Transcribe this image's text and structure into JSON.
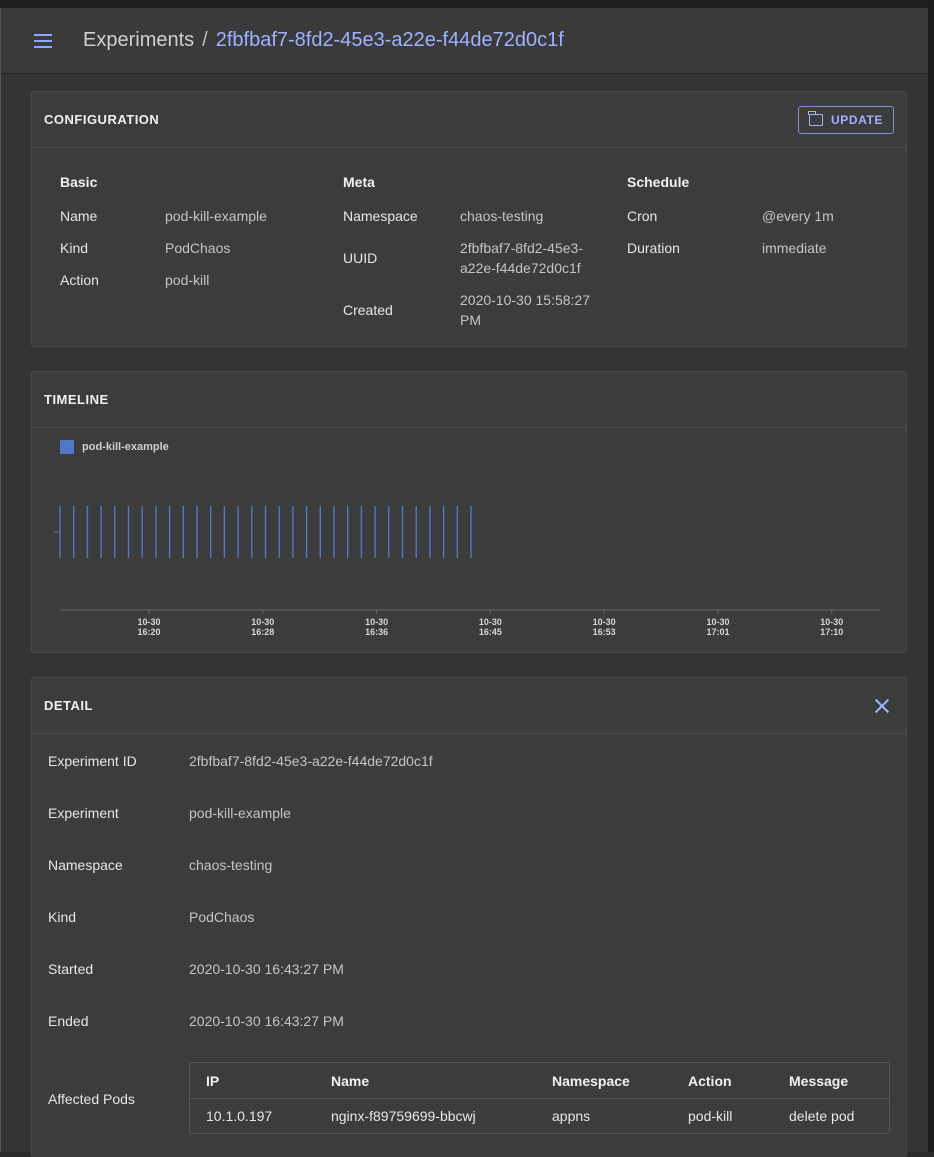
{
  "appbar": {
    "breadcrumb_root": "Experiments",
    "breadcrumb_sep": "/",
    "breadcrumb_current": "2fbfbaf7-8fd2-45e3-a22e-f44de72d0c1f"
  },
  "configuration": {
    "title": "CONFIGURATION",
    "update_label": "UPDATE",
    "basic": {
      "heading": "Basic",
      "name_key": "Name",
      "name_val": "pod-kill-example",
      "kind_key": "Kind",
      "kind_val": "PodChaos",
      "action_key": "Action",
      "action_val": "pod-kill"
    },
    "meta": {
      "heading": "Meta",
      "namespace_key": "Namespace",
      "namespace_val": "chaos-testing",
      "uuid_key": "UUID",
      "uuid_val_1": "2fbfbaf7-8fd2-45e3-",
      "uuid_val_2": "a22e-f44de72d0c1f",
      "created_key": "Created",
      "created_val_1": "2020-10-30 15:58:27",
      "created_val_2": "PM"
    },
    "schedule": {
      "heading": "Schedule",
      "cron_key": "Cron",
      "cron_val": "@every 1m",
      "duration_key": "Duration",
      "duration_val": "immediate"
    }
  },
  "timeline": {
    "title": "TIMELINE",
    "legend_label": "pod-kill-example",
    "series_color": "#4f79c4",
    "ticks": [
      {
        "date": "10-30",
        "time": "16:20"
      },
      {
        "date": "10-30",
        "time": "16:28"
      },
      {
        "date": "10-30",
        "time": "16:36"
      },
      {
        "date": "10-30",
        "time": "16:45"
      },
      {
        "date": "10-30",
        "time": "16:53"
      },
      {
        "date": "10-30",
        "time": "17:01"
      },
      {
        "date": "10-30",
        "time": "17:10"
      }
    ],
    "event_count": 31
  },
  "detail": {
    "title": "DETAIL",
    "rows": [
      {
        "key": "Experiment ID",
        "val": "2fbfbaf7-8fd2-45e3-a22e-f44de72d0c1f"
      },
      {
        "key": "Experiment",
        "val": "pod-kill-example"
      },
      {
        "key": "Namespace",
        "val": "chaos-testing"
      },
      {
        "key": "Kind",
        "val": "PodChaos"
      },
      {
        "key": "Started",
        "val": "2020-10-30 16:43:27 PM"
      },
      {
        "key": "Ended",
        "val": "2020-10-30 16:43:27 PM"
      }
    ],
    "affected_pods_label": "Affected Pods",
    "pods_columns": [
      "IP",
      "Name",
      "Namespace",
      "Action",
      "Message"
    ],
    "pods_rows": [
      [
        "10.1.0.197",
        "nginx-f89759699-bbcwj",
        "appns",
        "pod-kill",
        "delete pod"
      ]
    ]
  }
}
